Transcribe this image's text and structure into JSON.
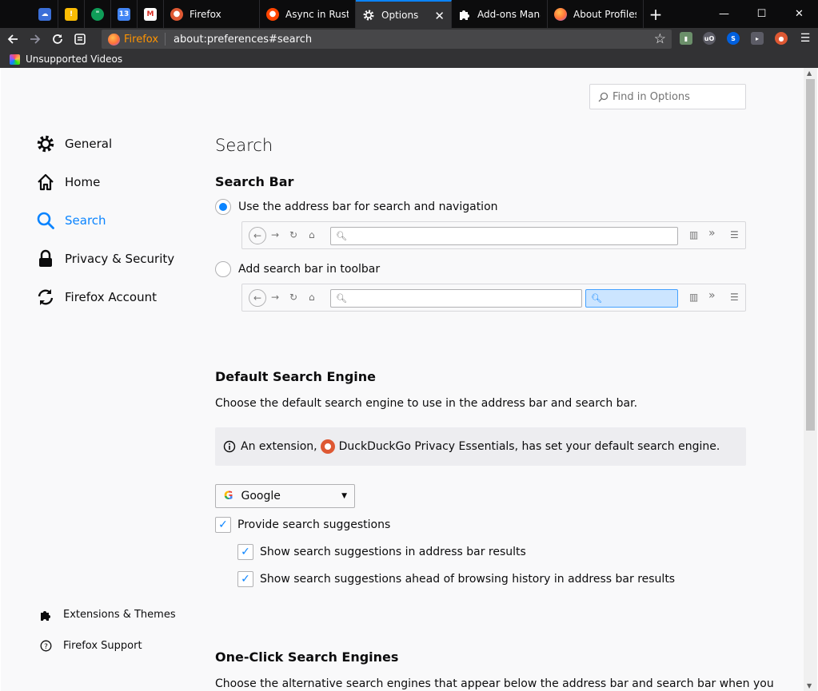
{
  "browser": {
    "pinned_tabs": [
      {
        "icon": "onedrive-icon",
        "color": "#0078d7",
        "text": ""
      },
      {
        "icon": "keep-icon",
        "color": "#fbbc04",
        "text": ""
      },
      {
        "icon": "hangouts-icon",
        "color": "#0f9d58",
        "text": ""
      },
      {
        "icon": "calendar-icon",
        "color": "#4285f4",
        "text": "13"
      },
      {
        "icon": "gmail-icon",
        "color": "#ffffff",
        "text": "M"
      }
    ],
    "tabs": [
      {
        "label": "Firefox",
        "icon": "duckduckgo-icon",
        "color": "#de5833",
        "active": false
      },
      {
        "label": "Async in Rust,",
        "icon": "reddit-icon",
        "color": "#ff4500",
        "active": false
      },
      {
        "label": "Options",
        "icon": "gear-icon",
        "color": "#f9f9fa",
        "active": true
      },
      {
        "label": "Add-ons Mana",
        "icon": "puzzle-icon",
        "color": "#f9f9fa",
        "active": false
      },
      {
        "label": "About Profiles",
        "icon": "firefox-icon",
        "color": "#ff7139",
        "active": false
      }
    ],
    "identity_label": "Firefox",
    "url": "about:preferences#search",
    "bookmark": "Unsupported Videos"
  },
  "prefs": {
    "find_placeholder": "Find in Options",
    "categories": [
      {
        "label": "General",
        "icon": "gear-icon"
      },
      {
        "label": "Home",
        "icon": "home-icon"
      },
      {
        "label": "Search",
        "icon": "search-icon",
        "selected": true
      },
      {
        "label": "Privacy & Security",
        "icon": "lock-icon"
      },
      {
        "label": "Firefox Account",
        "icon": "sync-icon"
      }
    ],
    "footer": [
      {
        "label": "Extensions & Themes",
        "icon": "puzzle-icon"
      },
      {
        "label": "Firefox Support",
        "icon": "help-icon"
      }
    ],
    "page_title": "Search",
    "search_bar": {
      "heading": "Search Bar",
      "option_address": "Use the address bar for search and navigation",
      "option_toolbar": "Add search bar in toolbar",
      "selected": "address"
    },
    "default_engine": {
      "heading": "Default Search Engine",
      "description": "Choose the default search engine to use in the address bar and search bar.",
      "notice_prefix": "An extension,",
      "notice_extension": "DuckDuckGo Privacy Essentials",
      "notice_suffix": ", has set your default search engine.",
      "engine_letter": "G",
      "engine": "Google"
    },
    "suggestions": {
      "provide": "Provide search suggestions",
      "address_bar": "Show search suggestions in address bar results",
      "ahead_history": "Show search suggestions ahead of browsing history in address bar results"
    },
    "one_click": {
      "heading": "One-Click Search Engines",
      "description": "Choose the alternative search engines that appear below the address bar and search bar when you"
    },
    "accent": "#0a84ff"
  }
}
